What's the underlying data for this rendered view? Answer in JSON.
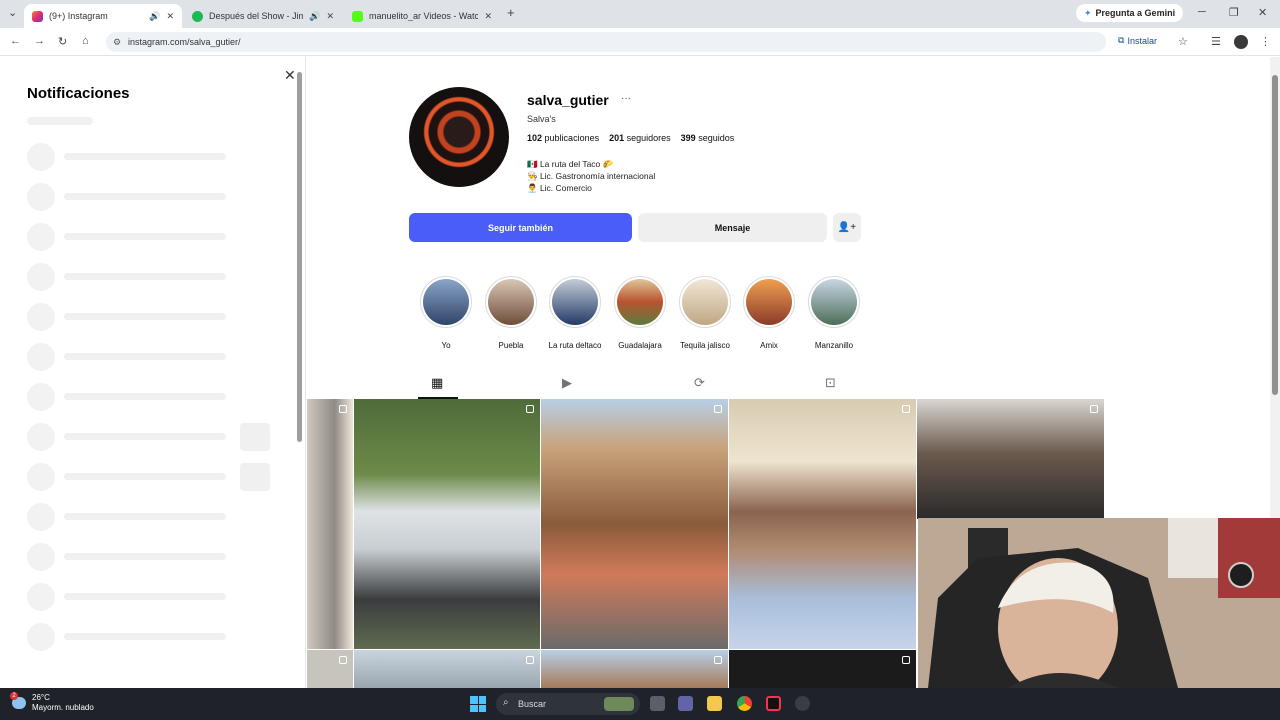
{
  "browser": {
    "tabs": [
      {
        "title": "(9+) Instagram",
        "active": true,
        "favicon_color": "#dd2a7b"
      },
      {
        "title": "Después del Show - Jimmy",
        "active": false,
        "favicon_color": "#1db954"
      },
      {
        "title": "manuelito_ar Videos - Watch C",
        "active": false,
        "favicon_color": "#53fc18"
      }
    ],
    "new_tab_label": "+",
    "gemini_label": "Pregunta a Gemini",
    "url": "instagram.com/salva_gutier/",
    "install_label": "Instalar"
  },
  "notifications": {
    "title": "Notificaciones"
  },
  "profile": {
    "username": "salva_gutier",
    "more": "···",
    "fullname": "Salva's",
    "stats": {
      "posts_value": "102",
      "posts_label": "publicaciones",
      "followers_value": "201",
      "followers_label": "seguidores",
      "following_value": "399",
      "following_label": "seguidos"
    },
    "bio": [
      "🇲🇽 La ruta del Taco 🌮",
      "👨‍🍳 Lic. Gastronomía internacional",
      "👨‍💼 Lic. Comercio"
    ],
    "follow_button": "Seguir también",
    "message_button": "Mensaje"
  },
  "highlights": [
    {
      "label": "Yo",
      "color": "#4a6fa5"
    },
    {
      "label": "Puebla",
      "color": "#8a6a55"
    },
    {
      "label": "La ruta deltaco",
      "color": "#3d5a8c"
    },
    {
      "label": "Guadalajara",
      "color": "#b8532f"
    },
    {
      "label": "Tequila jalisco",
      "color": "#d8c9b0"
    },
    {
      "label": "Amix",
      "color": "#c26a3a"
    },
    {
      "label": "Manzanillo",
      "color": "#6d8f7a"
    }
  ],
  "profile_tabs": [
    "grid-icon",
    "reels-icon",
    "reposts-icon",
    "tagged-icon"
  ],
  "taskbar": {
    "temperature": "26°C",
    "weather": "Mayorm. nublado",
    "notification_count": "2",
    "search_placeholder": "Buscar"
  }
}
